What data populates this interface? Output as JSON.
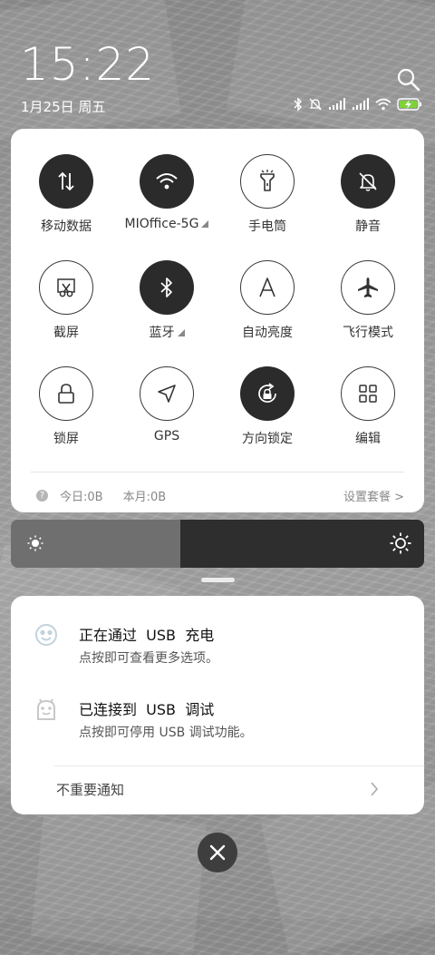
{
  "status": {
    "time": "15:22",
    "date": "1月25日 周五"
  },
  "quick_settings": {
    "tiles": [
      {
        "label": "移动数据",
        "state": "on",
        "icon": "mobile-data-icon"
      },
      {
        "label": "MIOffice-5G",
        "state": "on",
        "icon": "wifi-icon",
        "expandable": true
      },
      {
        "label": "手电筒",
        "state": "off",
        "icon": "flashlight-icon"
      },
      {
        "label": "静音",
        "state": "on",
        "icon": "mute-bell-icon"
      },
      {
        "label": "截屏",
        "state": "off",
        "icon": "screenshot-icon"
      },
      {
        "label": "蓝牙",
        "state": "on",
        "icon": "bluetooth-icon",
        "expandable": true
      },
      {
        "label": "自动亮度",
        "state": "off",
        "icon": "auto-brightness-icon"
      },
      {
        "label": "飞行模式",
        "state": "off",
        "icon": "airplane-icon"
      },
      {
        "label": "锁屏",
        "state": "off",
        "icon": "lock-icon"
      },
      {
        "label": "GPS",
        "state": "off",
        "icon": "gps-icon"
      },
      {
        "label": "方向锁定",
        "state": "on",
        "icon": "rotation-lock-icon"
      },
      {
        "label": "编辑",
        "state": "off",
        "icon": "edit-grid-icon"
      }
    ],
    "data_today": "今日:0B",
    "data_month": "本月:0B",
    "plan_settings": "设置套餐 >"
  },
  "brightness": {
    "level": 0.41
  },
  "notifications": {
    "items": [
      {
        "title": "正在通过  USB  充电",
        "subtitle": "点按即可查看更多选项。",
        "icon": "usb-charge-face-icon"
      },
      {
        "title": "已连接到  USB  调试",
        "subtitle": "点按即可停用 USB 调试功能。",
        "icon": "android-debug-icon"
      }
    ],
    "unimportant_label": "不重要通知"
  },
  "colors": {
    "tile_on": "#2b2b2b",
    "card_bg": "#ffffff",
    "battery_green": "#7ed23a"
  }
}
